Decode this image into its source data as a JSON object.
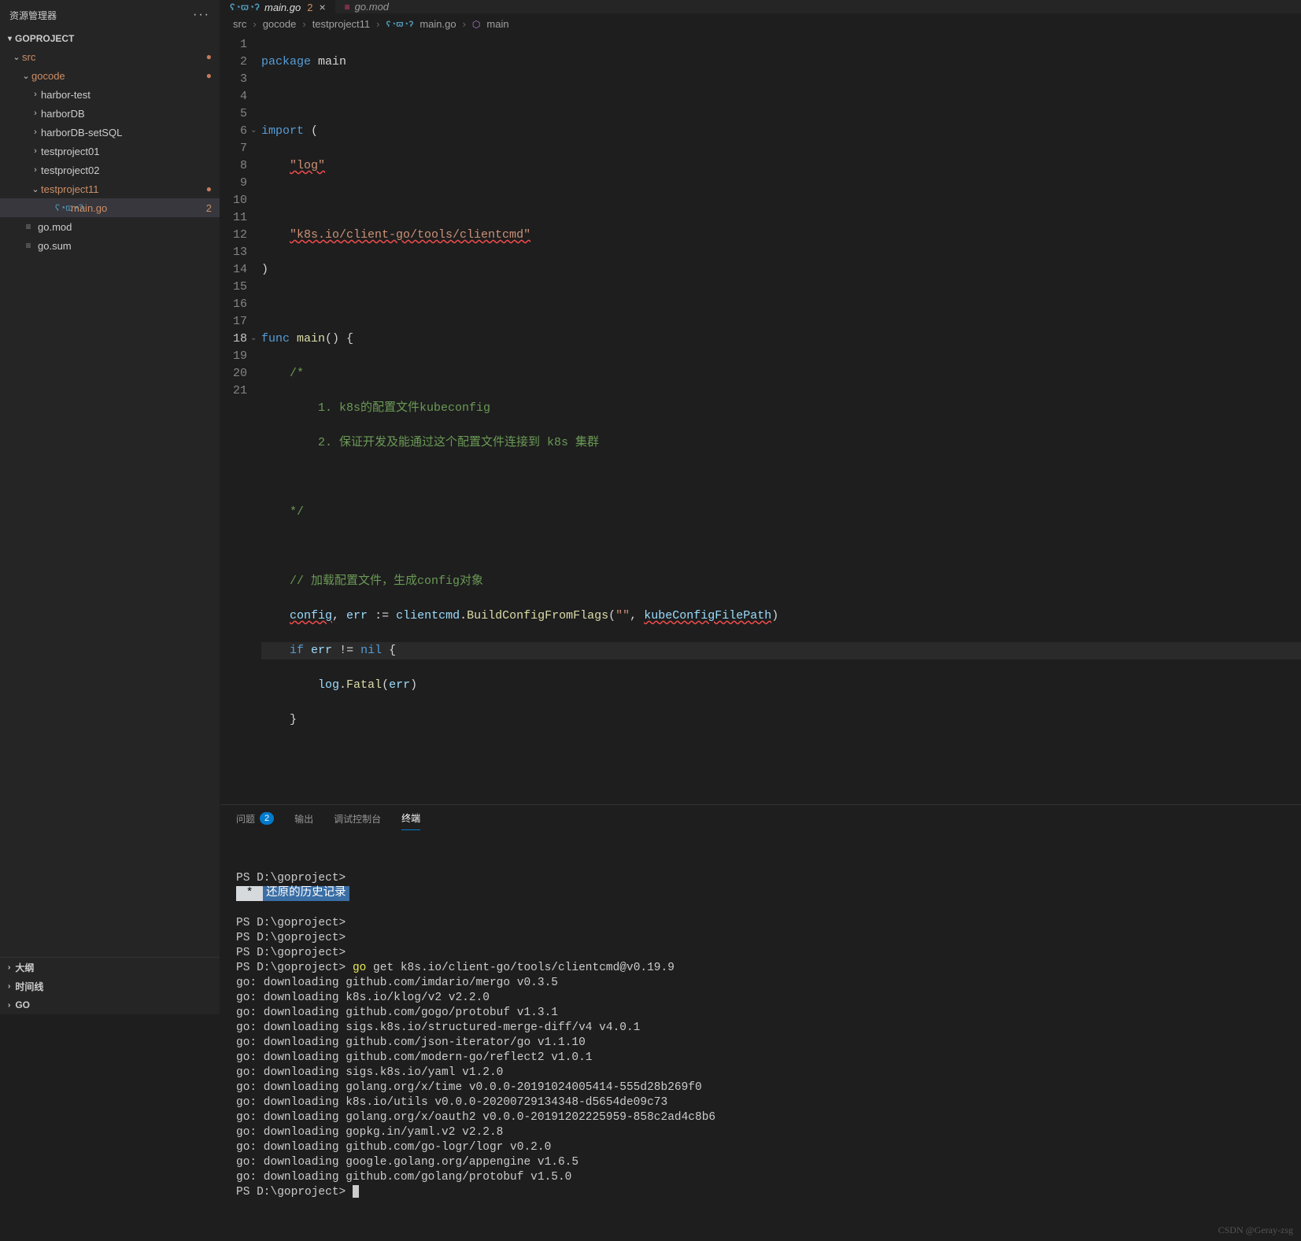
{
  "sidebar": {
    "title": "资源管理器",
    "project": "GOPROJECT",
    "tree": [
      {
        "indent": 14,
        "chev": "v",
        "label": "src",
        "cls": "orange",
        "dot": true
      },
      {
        "indent": 26,
        "chev": "v",
        "label": "gocode",
        "cls": "orange",
        "dot": true
      },
      {
        "indent": 38,
        "chev": ">",
        "label": "harbor-test"
      },
      {
        "indent": 38,
        "chev": ">",
        "label": "harborDB"
      },
      {
        "indent": 38,
        "chev": ">",
        "label": "harborDB-setSQL"
      },
      {
        "indent": 38,
        "chev": ">",
        "label": "testproject01"
      },
      {
        "indent": 38,
        "chev": ">",
        "label": "testproject02"
      },
      {
        "indent": 38,
        "chev": "v",
        "label": "testproject11",
        "cls": "orange",
        "dot": true
      },
      {
        "indent": 56,
        "icon": "go",
        "label": "main.go",
        "cls": "orange",
        "num": "2",
        "sel": true
      },
      {
        "indent": 14,
        "icon": "txt",
        "label": "go.mod"
      },
      {
        "indent": 14,
        "icon": "txt",
        "label": "go.sum"
      }
    ],
    "bottom": [
      {
        "chev": ">",
        "label": "大纲"
      },
      {
        "chev": ">",
        "label": "时间线"
      },
      {
        "chev": ">",
        "label": "GO"
      }
    ]
  },
  "tabs": [
    {
      "icon": "go",
      "name": "main.go",
      "badge": "2",
      "active": true,
      "close": true
    },
    {
      "icon": "mod",
      "name": "go.mod",
      "active": false
    }
  ],
  "crumbs": [
    "src",
    "gocode",
    "testproject11",
    "main.go",
    "main"
  ],
  "code": {
    "l1_kw": "package",
    "l1_id": "main",
    "l3_kw": "import",
    "l3_p": "(",
    "l4_s": "\"log\"",
    "l6_s": "\"k8s.io/client-go/tools/clientcmd\"",
    "l7_p": ")",
    "l9_kw": "func",
    "l9_fn": "main",
    "l9_p": "() {",
    "l10_c": "/*",
    "l11_c": "    1. k8s的配置文件kubeconfig",
    "l12_c": "    2. 保证开发及能通过这个配置文件连接到 k8s 集群",
    "l14_c": "*/",
    "l16_c": "// 加载配置文件，生成config对象",
    "l17_id1": "config",
    "l17_id2": "err",
    "l17_op": " := ",
    "l17_m1": "clientcmd",
    "l17_fn": "BuildConfigFromFlags",
    "l17_s1": "\"\"",
    "l17_id3": "kubeConfigFilePath",
    "l18_kw": "if",
    "l18_id": "err",
    "l18_op": " != ",
    "l18_nil": "nil",
    "l18_b": "{",
    "l19_m": "log",
    "l19_fn": "Fatal",
    "l19_id": "err",
    "l20_b": "}"
  },
  "panel": {
    "tabs": {
      "problems": "问题",
      "problems_count": "2",
      "output": "输出",
      "debug": "调试控制台",
      "terminal": "终端"
    },
    "term_prompt": "PS D:\\goproject>",
    "hist_star": " * ",
    "hist_label": "还原的历史记录",
    "go_cmd": "go",
    "cmd_rest": " get k8s.io/client-go/tools/clientcmd@v0.19.9",
    "lines": [
      "go: downloading github.com/imdario/mergo v0.3.5",
      "go: downloading k8s.io/klog/v2 v2.2.0",
      "go: downloading github.com/gogo/protobuf v1.3.1",
      "go: downloading sigs.k8s.io/structured-merge-diff/v4 v4.0.1",
      "go: downloading github.com/json-iterator/go v1.1.10",
      "go: downloading github.com/modern-go/reflect2 v1.0.1",
      "go: downloading sigs.k8s.io/yaml v1.2.0",
      "go: downloading golang.org/x/time v0.0.0-20191024005414-555d28b269f0",
      "go: downloading k8s.io/utils v0.0.0-20200729134348-d5654de09c73",
      "go: downloading golang.org/x/oauth2 v0.0.0-20191202225959-858c2ad4c8b6",
      "go: downloading gopkg.in/yaml.v2 v2.2.8",
      "go: downloading github.com/go-logr/logr v0.2.0",
      "go: downloading google.golang.org/appengine v1.6.5",
      "go: downloading github.com/golang/protobuf v1.5.0"
    ]
  },
  "watermark": "CSDN @Geray-zsg"
}
